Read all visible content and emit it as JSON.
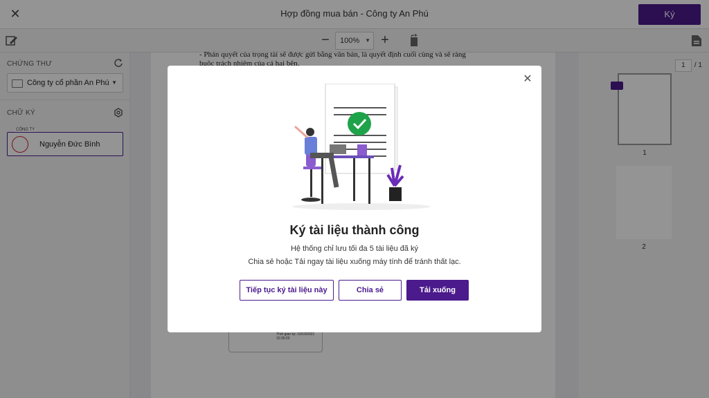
{
  "topbar": {
    "title": "Hợp đồng mua bán - Công ty An Phú",
    "sign_label": "Ký"
  },
  "toolbar": {
    "zoom_value": "100%"
  },
  "sidebar": {
    "cert_heading": "CHỨNG THƯ",
    "cert_selected": "Công ty cổ phần An Phú",
    "sig_heading": "CHỮ KÝ",
    "sig_company": "CÔNG TY",
    "sig_name": "Nguyễn Đức Bình"
  },
  "document": {
    "line1": "- Phán quyết của trọng tài sẽ được gửi bằng văn bản, là quyết định cuối cùng và sẽ ràng",
    "line2": "buộc trách nhiệm của cả hai bên.",
    "sig_time": "Thời gian ký: 19/10/2021 10:30:23"
  },
  "thumbnails": {
    "current_page": "1",
    "total_pages": "/ 1",
    "pages": [
      "1",
      "2"
    ]
  },
  "modal": {
    "title": "Ký tài liệu thành công",
    "line1": "Hệ thống chỉ lưu tối đa 5 tài liệu đã ký",
    "line2": "Chia sẻ hoặc Tải ngay tài liệu xuống máy tính để tránh thất lạc.",
    "btn_continue": "Tiếp tục ký tài liệu này",
    "btn_share": "Chia sẻ",
    "btn_download": "Tải xuống"
  },
  "colors": {
    "accent": "#4b1a8c",
    "success": "#1fa34a"
  },
  "icons": [
    "close-icon",
    "signature-edit-icon",
    "zoom-out-icon",
    "zoom-in-icon",
    "rotate-icon",
    "document-icon",
    "refresh-icon",
    "settings-icon",
    "certificate-icon",
    "chevron-down-icon",
    "success-check-icon"
  ]
}
